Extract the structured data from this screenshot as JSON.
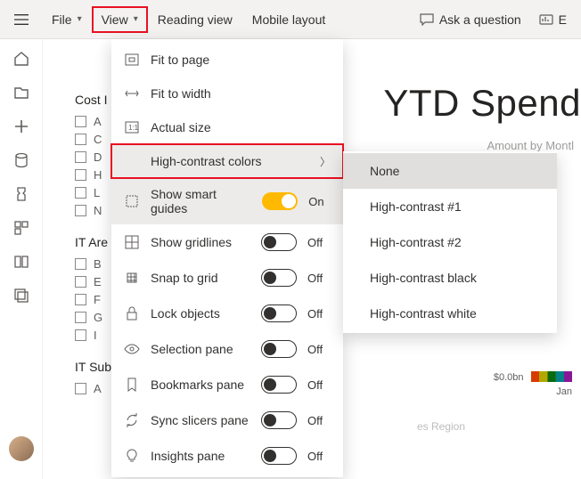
{
  "topbar": {
    "file": "File",
    "view": "View",
    "reading_view": "Reading view",
    "mobile_layout": "Mobile layout",
    "ask": "Ask a question",
    "extra": "E"
  },
  "report": {
    "title": "YTD Spend",
    "subtitle": "Amount by Montl",
    "region_label": "es Region",
    "legend_value": "$0.0bn",
    "legend_month": "Jan"
  },
  "slicers": {
    "group1_head": "Cost I",
    "group1_items": [
      "A",
      "C",
      "D",
      "H",
      "L",
      "N"
    ],
    "group2_head": "IT Are",
    "group2_items": [
      "B",
      "E",
      "F",
      "G",
      "I"
    ],
    "group3_head": "IT Sub",
    "group3_items": [
      "A"
    ]
  },
  "view_menu": {
    "fit_page": "Fit to page",
    "fit_width": "Fit to width",
    "actual_size": "Actual size",
    "high_contrast": "High-contrast colors",
    "smart_guides": "Show smart guides",
    "gridlines": "Show gridlines",
    "snap": "Snap to grid",
    "lock": "Lock objects",
    "selection": "Selection pane",
    "bookmarks": "Bookmarks pane",
    "sync": "Sync slicers pane",
    "insights": "Insights pane",
    "on": "On",
    "off": "Off"
  },
  "contrast_menu": {
    "none": "None",
    "hc1": "High-contrast #1",
    "hc2": "High-contrast #2",
    "black": "High-contrast black",
    "white": "High-contrast white"
  }
}
